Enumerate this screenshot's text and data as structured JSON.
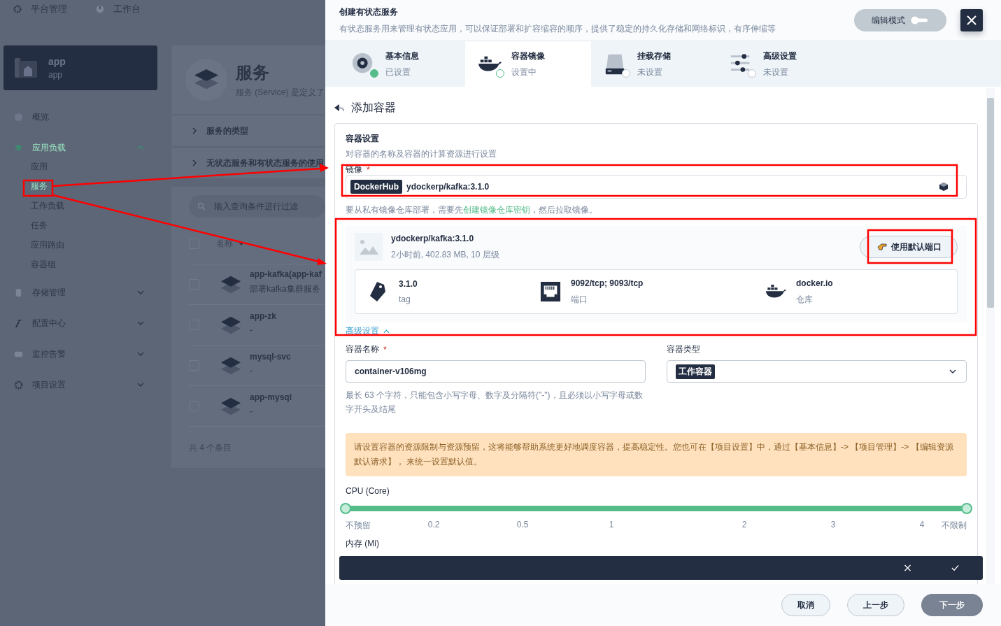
{
  "top_nav": [
    {
      "label": "平台管理"
    },
    {
      "label": "工作台"
    }
  ],
  "project": {
    "name": "app",
    "alias": "app"
  },
  "sidebar": {
    "items": [
      {
        "label": "概览",
        "selected": false
      },
      {
        "label": "应用负载",
        "selected": true,
        "expanded": true,
        "children": [
          {
            "label": "应用",
            "selected": false
          },
          {
            "label": "服务",
            "selected": true
          },
          {
            "label": "工作负载",
            "selected": false
          },
          {
            "label": "任务",
            "selected": false
          },
          {
            "label": "应用路由",
            "selected": false
          },
          {
            "label": "容器组",
            "selected": false
          }
        ]
      },
      {
        "label": "存储管理",
        "selected": false,
        "expanded": false
      },
      {
        "label": "配置中心",
        "selected": false,
        "expanded": false
      },
      {
        "label": "监控告警",
        "selected": false,
        "expanded": false
      },
      {
        "label": "项目设置",
        "selected": false,
        "expanded": false
      }
    ]
  },
  "service_page": {
    "title": "服务",
    "description": "服务 (Service) 是定义了",
    "sections": [
      {
        "label": "服务的类型",
        "expanded": false
      },
      {
        "label": "无状态服务和有状态服务的使用",
        "expanded": false
      }
    ],
    "search": {
      "placeholder": "输入查询条件进行过滤"
    },
    "table": {
      "columns": [
        "名称"
      ],
      "header_checked": false,
      "rows": [
        {
          "name": "app-kafka(app-kaf",
          "description": "部署kafka集群服务",
          "checked": false
        },
        {
          "name": "app-zk",
          "description": "-",
          "checked": false
        },
        {
          "name": "mysql-svc",
          "description": "-",
          "checked": false
        },
        {
          "name": "app-mysql",
          "description": "-",
          "checked": false
        }
      ]
    },
    "total": "共 4 个条目"
  },
  "modal": {
    "title": "创建有状态服务",
    "description": "有状态服务用来管理有状态应用，可以保证部署和扩容缩容的顺序，提供了稳定的持久化存储和网络标识，有序伸缩等",
    "edit_mode": {
      "label": "编辑模式",
      "on": false
    },
    "steps": [
      {
        "title": "基本信息",
        "status": "已设置",
        "completed": true,
        "selected": false
      },
      {
        "title": "容器镜像",
        "status": "设置中",
        "completed": false,
        "selected": true
      },
      {
        "title": "挂载存储",
        "status": "未设置",
        "completed": false,
        "selected": false
      },
      {
        "title": "高级设置",
        "status": "未设置",
        "completed": false,
        "selected": false
      }
    ],
    "page_title": "添加容器",
    "container_settings": {
      "title": "容器设置",
      "description": "对容器的名称及容器的计算资源进行设置",
      "image_field": {
        "label": "镜像",
        "required_mark": "*",
        "registry": "DockerHub",
        "value": "ydockerp/kafka:3.1.0"
      },
      "image_hint": {
        "before": "要从私有镜像仓库部署，需要先",
        "link": "创建镜像仓库密钥",
        "after": "，然后拉取镜像。"
      },
      "image_card": {
        "name": "ydockerp/kafka:3.1.0",
        "meta": "2小时前, 402.83 MB, 10 层级",
        "button": "使用默认端口",
        "details": [
          {
            "value": "3.1.0",
            "label": "tag"
          },
          {
            "value": "9092/tcp; 9093/tcp",
            "label": "端口"
          },
          {
            "value": "docker.io",
            "label": "仓库"
          }
        ]
      },
      "advanced": {
        "label": "高级设置",
        "expanded": true
      },
      "name_field": {
        "label": "容器名称",
        "required_mark": "*",
        "value": "container-v106mg",
        "hint": "最长 63 个字符，只能包含小写字母、数字及分隔符(\"-\")，且必须以小写字母或数字开头及结尾"
      },
      "type_field": {
        "label": "容器类型",
        "value": "工作容器"
      },
      "notice": "请设置容器的资源限制与资源预留，这将能够帮助系统更好地调度容器，提高稳定性。您也可在【项目设置】中，通过【基本信息】-> 【项目管理】-> 【编辑资源默认请求】， 来统一设置默认值。",
      "cpu": {
        "label": "CPU (Core)",
        "thumbs": [
          {
            "level": 0
          },
          {
            "level": 1
          }
        ],
        "ticks": [
          "不预留",
          "0.2",
          "0.5",
          "1",
          "2",
          "3",
          "4",
          "不限制"
        ]
      },
      "memory": {
        "label": "内存 (Mi)"
      }
    },
    "buttons": [
      {
        "label": "取消",
        "kind": "default"
      },
      {
        "label": "上一步",
        "kind": "default"
      },
      {
        "label": "下一步",
        "kind": "primary"
      }
    ]
  }
}
